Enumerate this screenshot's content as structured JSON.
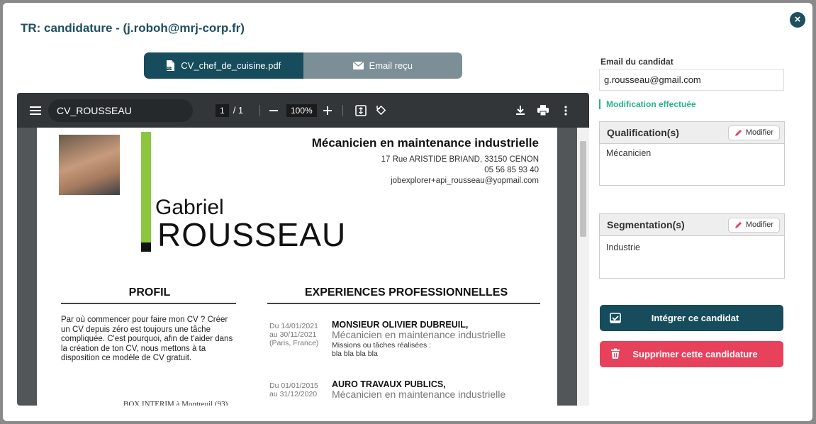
{
  "modal": {
    "title": "TR: candidature - (j.roboh@mrj-corp.fr)",
    "close_icon": "×"
  },
  "tabs": [
    {
      "label": "CV_chef_de_cuisine.pdf",
      "icon": "pdf-file-icon",
      "active": true
    },
    {
      "label": "Email reçu",
      "icon": "envelope-icon",
      "active": false
    }
  ],
  "viewer": {
    "document_title": "CV_ROUSSEAU",
    "page_current": "1",
    "page_total": "/ 1",
    "zoom": "100%"
  },
  "cv": {
    "first_name": "Gabriel",
    "last_name": "ROUSSEAU",
    "job_title": "Mécanicien en maintenance industrielle",
    "address": "17 Rue ARISTIDE BRIAND, 33150 CENON",
    "phone": "05 56 85 93 40",
    "email": "jobexplorer+api_rousseau@yopmail.com",
    "profil_heading": "PROFIL",
    "profil_text": "Par où commencer pour faire mon CV ? Créer un CV depuis zéro est toujours une tâche compliquée. C'est pourquoi, afin de t'aider dans la création de ton CV, nous mettons à ta disposition ce modèle de CV gratuit.",
    "experiences_heading": "EXPERIENCES PROFESSIONNELLES",
    "experiences": [
      {
        "date_from": "Du 14/01/2021",
        "date_to": "au 30/11/2021",
        "location": "(Paris, France)",
        "company": "MONSIEUR OLIVIER DUBREUIL,",
        "role": "Mécanicien en maintenance industrielle",
        "missions_label": "Missions ou tâches réalisées :",
        "missions": "bla bla bla bla"
      },
      {
        "date_from": "Du 01/01/2015",
        "date_to": "au 31/12/2020",
        "company": "AURO TRAVAUX PUBLICS,",
        "role": "Mécanicien en maintenance industrielle"
      }
    ],
    "cut_text": "BOX INTERIM à Montreuil (93)"
  },
  "sidebar": {
    "email_label": "Email du candidat",
    "email_value": "g.rousseau@gmail.com",
    "modification_note": "Modification effectuée",
    "qualification": {
      "title": "Qualification(s)",
      "button": "Modifier",
      "value": "Mécanicien"
    },
    "segmentation": {
      "title": "Segmentation(s)",
      "button": "Modifier",
      "value": "Industrie"
    },
    "integrate_button": "Intégrer ce candidat",
    "delete_button": "Supprimer cette candidature"
  },
  "colors": {
    "primary": "#164c5c",
    "danger": "#e8415b",
    "success": "#26b38a",
    "accent_green": "#8cc63f"
  }
}
